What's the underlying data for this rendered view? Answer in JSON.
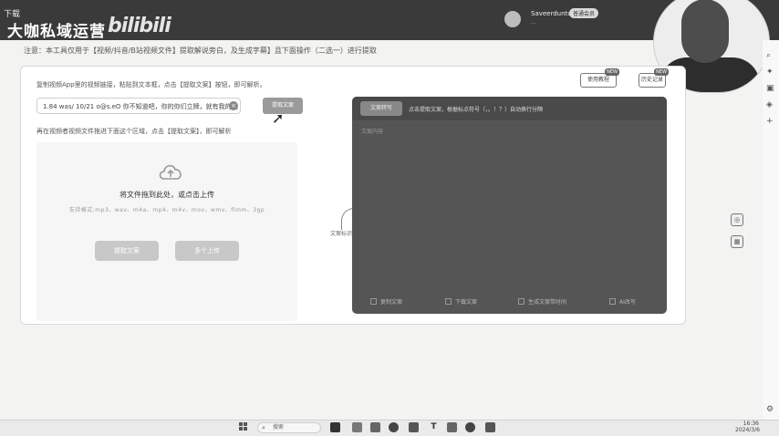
{
  "header": {
    "download_label": "下载",
    "brand": "大咖私域运营",
    "logo_text": "bilibili",
    "user_name": "Saveerduntu",
    "user_badge": "普通会员",
    "user_status": "..."
  },
  "notice": "注意：本工具仅用于【视频/抖音/B站视频文件】提取解说旁白，及生成字幕】且下面操作（二选一）进行提取",
  "link_section": {
    "hint": "复制视频App里的视频链接，粘贴到文本框，点击【提取文案】按钮，即可解析。",
    "input_value": "1.84 was/ 10/21 o@s.eO 你不知道吧，你的你们立牌，就有我的我",
    "extract_button": "提取文案"
  },
  "top_buttons": {
    "guide": "使用教程",
    "guide_tag": "NEW",
    "history": "历史记录",
    "history_tag": "NEW"
  },
  "upload_section": {
    "hint": "再在视频者视频文件拖进下面这个区域，点击【提取文案】，即可解析",
    "drop_title": "将文件拖到此处，或点击上传",
    "formats": "支持格式:mp3、wav、m4a、mp4、m4v、mov、wmv、flmm、3gp",
    "btn_extract": "提取文案",
    "btn_upload": "多个上传"
  },
  "mid_label": "文案标识...",
  "output": {
    "transcribe_btn": "文案转写",
    "note": "点击提取文案，根据标点符号（，。！？）自动换行分隔",
    "sub": "文案内容",
    "footer": [
      "复制文案",
      "下载文案",
      "生成文案带时间",
      "AI改写"
    ]
  },
  "taskbar": {
    "search_placeholder": "搜索",
    "time": "16:36",
    "date": "2024/3/6"
  }
}
